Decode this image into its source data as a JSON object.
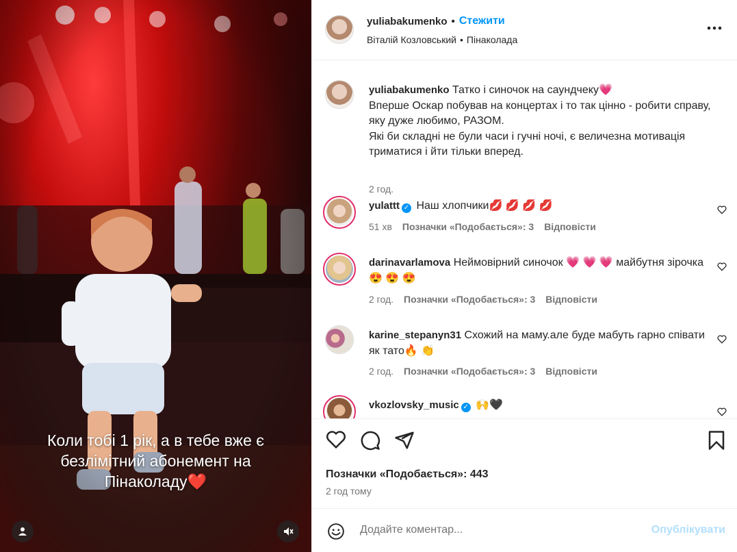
{
  "video": {
    "overlay_text": "Коли тобі 1 рік, а в тебе вже є\nбезлімітний абонемент на\nПінаколаду❤️"
  },
  "header": {
    "username": "yuliabakumenko",
    "dot": "•",
    "follow_label": "Стежити",
    "audio_artist": "Віталій Козловський",
    "audio_song": "Пінаколада",
    "more_icon": "more-horizontal-icon"
  },
  "caption": {
    "username": "yuliabakumenko",
    "text": "Татко і синочок на саундчеку💗\nВперше Оскар побував на концертах і то так цінно - робити справу, яку дуже любимо, РАЗОМ.\nЯкі би складні не були часи і гучні ночі, є величезна мотивація триматися і йти тільки вперед.",
    "time": "2 год."
  },
  "comments": [
    {
      "username": "yulattt",
      "verified": true,
      "text": "Наш хлопчики💋 💋 💋 💋",
      "time": "51 хв",
      "likes": "Позначки «Подобається»: 3",
      "reply": "Відповісти",
      "avatar_color": "#c9a27e"
    },
    {
      "username": "darinavarlamova",
      "verified": false,
      "text": "Неймовірний синочок 💗 💗 💗  майбутня зірочка 😍 😍 😍",
      "time": "2 год.",
      "likes": "Позначки «Подобається»: 3",
      "reply": "Відповісти",
      "avatar_color": "#e2c48f"
    },
    {
      "username": "karine_stepanyn31",
      "verified": false,
      "text": "Схожий на маму.але буде мабуть гарно співати як тато🔥 👏",
      "time": "2 год.",
      "likes": "Позначки «Подобається»: 3",
      "reply": "Відповісти",
      "avatar_color": "#b86a8c"
    },
    {
      "username": "vkozlovsky_music",
      "verified": true,
      "text": "🙌🖤",
      "time": "",
      "likes": "",
      "reply": "",
      "avatar_color": "#8a5a3b"
    }
  ],
  "footer": {
    "likes_count": "Позначки «Подобається»: 443",
    "posted_ago": "2 год тому",
    "comment_placeholder": "Додайте коментар...",
    "publish_label": "Опублікувати"
  },
  "colors": {
    "accent": "#0095f6",
    "story_ring": "#e1306c"
  }
}
